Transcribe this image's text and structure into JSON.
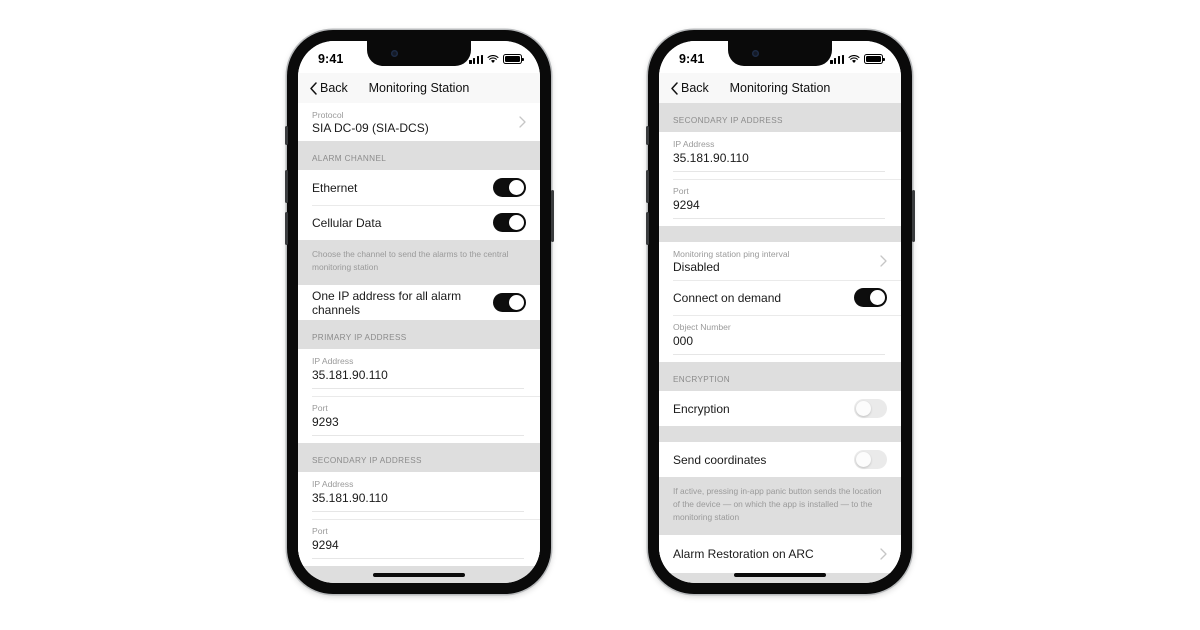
{
  "meta": {
    "app_screen_title": "Monitoring Station"
  },
  "status_bar": {
    "time": "9:41",
    "icons": [
      "cellular-signal-icon",
      "wifi-icon",
      "battery-icon"
    ]
  },
  "nav": {
    "back_label": "Back",
    "title": "Monitoring Station",
    "back_icon": "chevron-left-icon"
  },
  "phone_left": {
    "rows": [
      {
        "kind": "cell-disclosure",
        "label": "Protocol",
        "value": "SIA DC-09 (SIA-DCS)"
      },
      {
        "kind": "section",
        "title": "ALARM CHANNEL"
      },
      {
        "kind": "toggle",
        "title": "Ethernet",
        "state": "on"
      },
      {
        "kind": "toggle",
        "title": "Cellular Data",
        "state": "on"
      },
      {
        "kind": "footnote",
        "text": "Choose the channel to send the alarms to the central monitoring station"
      },
      {
        "kind": "toggle",
        "title": "One IP address for all alarm channels",
        "state": "on"
      },
      {
        "kind": "section",
        "title": "PRIMARY IP ADDRESS"
      },
      {
        "kind": "field",
        "label": "IP Address",
        "value": "35.181.90.110"
      },
      {
        "kind": "field",
        "label": "Port",
        "value": "9293"
      },
      {
        "kind": "section",
        "title": "SECONDARY IP ADDRESS"
      },
      {
        "kind": "field",
        "label": "IP Address",
        "value": "35.181.90.110"
      },
      {
        "kind": "field",
        "label": "Port",
        "value": "9294"
      }
    ]
  },
  "phone_right": {
    "rows": [
      {
        "kind": "section",
        "title": "SECONDARY IP ADDRESS"
      },
      {
        "kind": "field",
        "label": "IP Address",
        "value": "35.181.90.110"
      },
      {
        "kind": "field",
        "label": "Port",
        "value": "9294"
      },
      {
        "kind": "gap"
      },
      {
        "kind": "cell-disclosure",
        "label": "Monitoring station ping interval",
        "value": "Disabled"
      },
      {
        "kind": "toggle",
        "title": "Connect on demand",
        "state": "on"
      },
      {
        "kind": "field",
        "label": "Object Number",
        "value": "000"
      },
      {
        "kind": "section",
        "title": "ENCRYPTION"
      },
      {
        "kind": "toggle",
        "title": "Encryption",
        "state": "off"
      },
      {
        "kind": "gap"
      },
      {
        "kind": "toggle",
        "title": "Send coordinates",
        "state": "off"
      },
      {
        "kind": "footnote",
        "text": "If active, pressing in-app panic button sends the location of the device — on which the app is installed — to the monitoring station"
      },
      {
        "kind": "title-disclosure",
        "title": "Alarm Restoration on ARC"
      }
    ]
  },
  "colors": {
    "background": "#ffffff",
    "list_background": "#dedede",
    "cell_background": "#ffffff",
    "switch_on": "#0d0d0d",
    "switch_off": "#eaeaea",
    "primary_text": "#1a1a1a",
    "secondary_text": "#9a9a9a",
    "nav_background": "#f8f8f8"
  }
}
